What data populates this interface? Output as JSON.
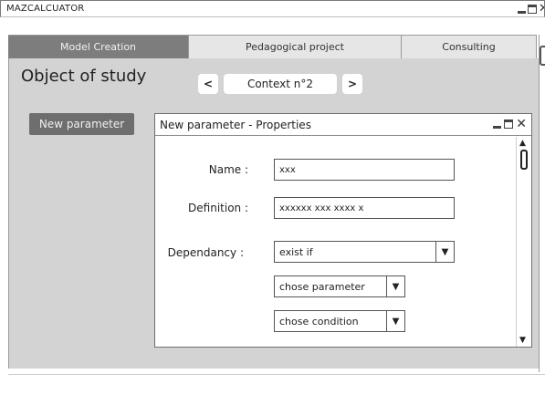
{
  "app": {
    "title": "MAZCALCUATOR"
  },
  "tabs": [
    {
      "label": "Model Creation"
    },
    {
      "label": "Pedagogical project"
    },
    {
      "label": "Consulting"
    }
  ],
  "main": {
    "page_title": "Object of study",
    "context": {
      "prev_icon": "<",
      "label": "Context n°2",
      "next_icon": ">"
    },
    "new_parameter_button": "New parameter"
  },
  "dialog": {
    "title": "New parameter - Properties",
    "form": {
      "name_label": "Name :",
      "name_value": "xxx",
      "definition_label": "Definition :",
      "definition_value": "xxxxxx xxx  xxxx x",
      "dependancy_label": "Dependancy :",
      "dependancy_value": "exist if",
      "parameter_select": "chose parameter",
      "condition_select": "chose condition"
    }
  },
  "icons": {
    "min": "minimize-icon",
    "max": "maximize-icon",
    "close": "close-icon",
    "dropdown": "dropdown-arrow-icon",
    "scroll_up": "scroll-up-icon",
    "scroll_down": "scroll-down-icon"
  },
  "colors": {
    "active_tab": "#7d7d7d",
    "inactive_tab": "#e6e6e6",
    "content_bg": "#d3d3d3",
    "button_bg": "#6e6e6e"
  }
}
